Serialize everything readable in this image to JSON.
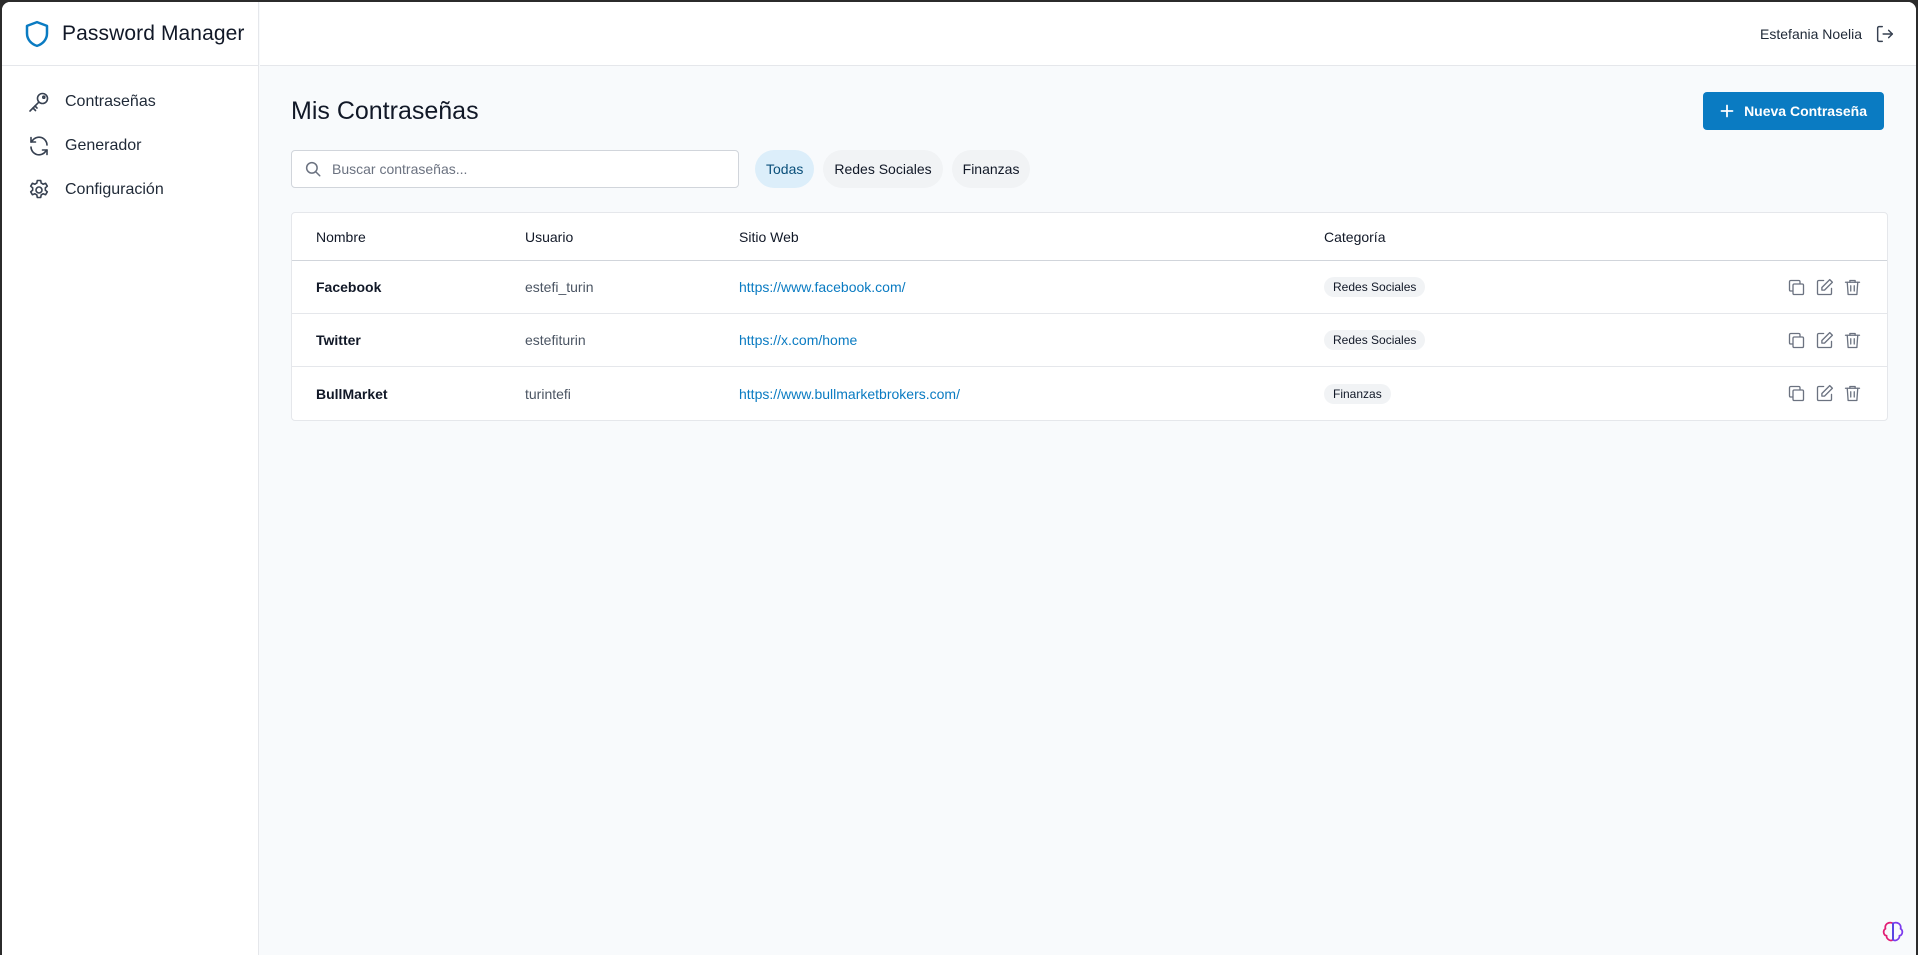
{
  "app": {
    "title": "Password Manager"
  },
  "sidebar": {
    "items": [
      {
        "label": "Contraseñas",
        "icon": "key-icon"
      },
      {
        "label": "Generador",
        "icon": "refresh-icon"
      },
      {
        "label": "Configuración",
        "icon": "gear-icon"
      }
    ]
  },
  "topbar": {
    "user_name": "Estefania Noelia",
    "logout_icon": "logout-icon"
  },
  "main": {
    "title": "Mis Contraseñas",
    "new_button_label": "Nueva Contraseña",
    "search": {
      "placeholder": "Buscar contraseñas...",
      "value": ""
    },
    "filters": [
      "Todas",
      "Redes Sociales",
      "Finanzas"
    ],
    "active_filter": "Todas",
    "table": {
      "headers": {
        "name": "Nombre",
        "user": "Usuario",
        "site": "Sitio Web",
        "category": "Categoría"
      },
      "rows": [
        {
          "name": "Facebook",
          "user": "estefi_turin",
          "site": "https://www.facebook.com/",
          "category": "Redes Sociales"
        },
        {
          "name": "Twitter",
          "user": "estefiturin",
          "site": "https://x.com/home",
          "category": "Redes Sociales"
        },
        {
          "name": "BullMarket",
          "user": "turintefi",
          "site": "https://www.bullmarketbrokers.com/",
          "category": "Finanzas"
        }
      ]
    }
  },
  "colors": {
    "accent": "#0a7bc2",
    "active_chip_bg": "#dceefa",
    "background": "#f8fafc"
  }
}
